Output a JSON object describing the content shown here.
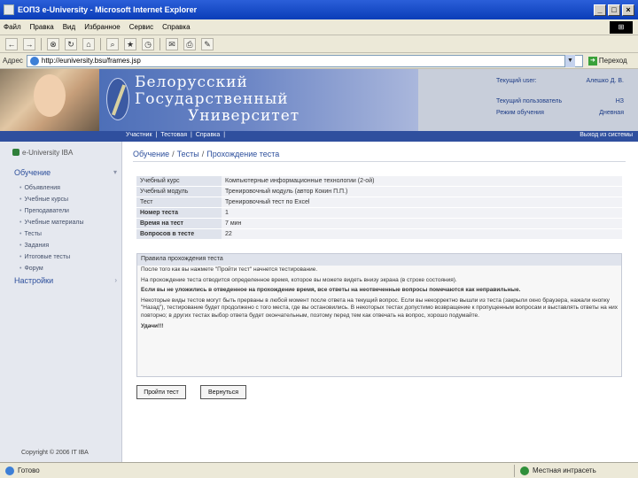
{
  "window": {
    "title": "ЕОПЗ e-University - Microsoft Internet Explorer",
    "min": "_",
    "max": "□",
    "close": "×"
  },
  "menu": [
    "Файл",
    "Правка",
    "Вид",
    "Избранное",
    "Сервис",
    "Справка"
  ],
  "toolbar_icons": [
    "back-icon",
    "forward-icon",
    "stop-icon",
    "refresh-icon",
    "home-icon",
    "search-icon",
    "favorites-icon",
    "history-icon",
    "mail-icon",
    "print-icon",
    "edit-icon"
  ],
  "address": {
    "label": "Адрес",
    "value": "http://euniversity.bsu/frames.jsp",
    "go_label": "Переход"
  },
  "header": {
    "university": [
      "Белорусский",
      "Государственный",
      "Университет"
    ],
    "current_user_label": "Текущий user:",
    "current_user_value": "Алешко Д. В.",
    "current_role_label": "Текущий пользователь",
    "current_role_value": "НЗ",
    "mode_label": "Режим обучения",
    "mode_value": "Дневная"
  },
  "topnav": {
    "links": [
      "Участник",
      "Тестовая",
      "Справка"
    ],
    "exit": "Выход из системы"
  },
  "sidebar": {
    "brand": "e-University IBA",
    "section1": "Обучение",
    "items": [
      "Объявления",
      "Учебные курсы",
      "Преподаватели",
      "Учебные материалы",
      "Тесты",
      "Задания",
      "Итоговые тесты",
      "Форум"
    ],
    "section2": "Настройки",
    "copyright": "Copyright © 2006 IT IBA"
  },
  "breadcrumb": {
    "a": "Обучение",
    "b": "Тесты",
    "c": "Прохождение теста"
  },
  "info": [
    {
      "k": "Учебный курс",
      "v": "Компьютерные информационные технологии (2-ой)",
      "bold": false
    },
    {
      "k": "Учебный модуль",
      "v": "Тренировочный модуль (автор Кокин П.П.)",
      "bold": false
    },
    {
      "k": "Тест",
      "v": "Тренировочный тест по Excel",
      "bold": false
    },
    {
      "k": "Номер теста",
      "v": "1",
      "bold": true
    },
    {
      "k": "Время на тест",
      "v": "7 мин",
      "bold": true
    },
    {
      "k": "Вопросов в тесте",
      "v": "22",
      "bold": true
    }
  ],
  "rules": {
    "heading": "Правила прохождения теста",
    "p1": "После того как вы нажмете \"Пройти тест\" начнется тестирование.",
    "p2": "На прохождение теста отводится определенное время, которое вы можете видеть внизу экрана (в строке состояния).",
    "p3": "Если вы не уложились в отведенное на прохождение время, все ответы на неотвеченные вопросы помечаются как неправильные.",
    "p4": "Некоторые виды тестов могут быть прерваны в любой момент после ответа на текущий вопрос. Если вы некорректно вышли из теста (закрыли окно браузера, нажали кнопку \"Назад\"), тестирование будет продолжено с того места, где вы остановились. В некоторых тестах допустимо возвращение к пропущенным вопросам и выставлять ответы на них повторно; в других тестах выбор ответа будет окончательным, поэтому перед тем как отвечать на вопрос, хорошо подумайте.",
    "p5": "Удачи!!!"
  },
  "buttons": {
    "start": "Пройти тест",
    "back": "Вернуться"
  },
  "status": {
    "text": "Готово",
    "zone": "Местная интрасеть"
  }
}
